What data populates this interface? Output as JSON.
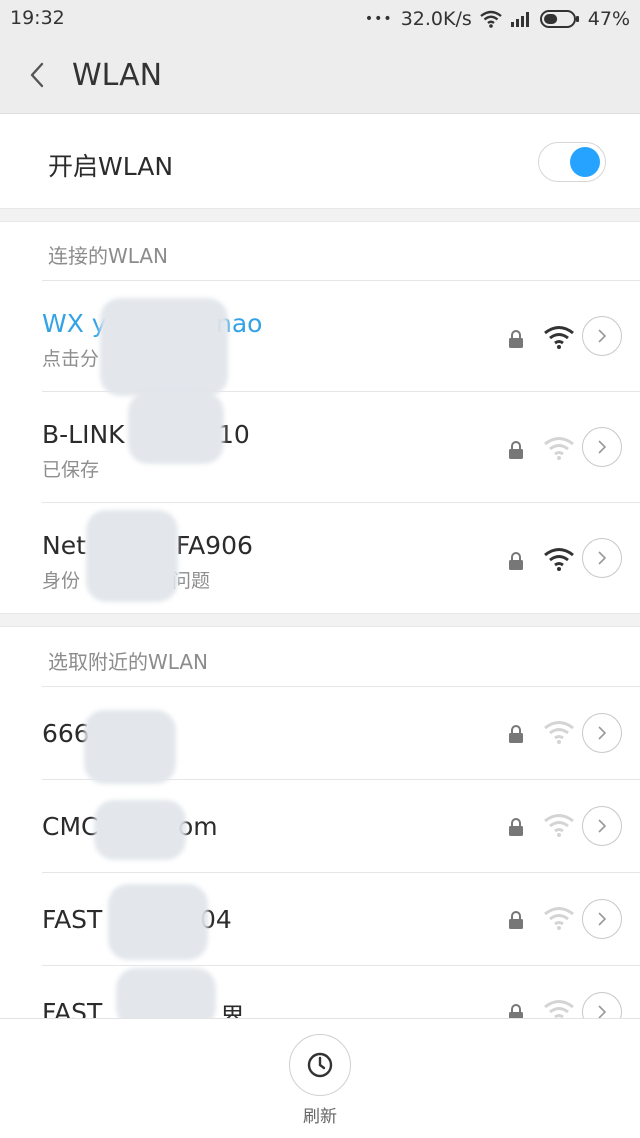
{
  "status_bar": {
    "time": "19:32",
    "dots": "•••",
    "speed": "32.0K/s",
    "battery": "47%",
    "battery_level": 0.47
  },
  "header": {
    "title": "WLAN"
  },
  "master_toggle": {
    "label": "开启WLAN",
    "on": true,
    "accent": "#26a3ff"
  },
  "connected_section": {
    "title": "连接的WLAN",
    "networks": [
      {
        "name": "WX y",
        "name_tail": "nao",
        "status": "点击分",
        "secured": true,
        "signal": "strong",
        "connected": true
      },
      {
        "name": "B-LINK",
        "name_tail": "10",
        "status": "已保存",
        "secured": true,
        "signal": "weak",
        "connected": false
      },
      {
        "name": "Net",
        "name_tail": "FA906",
        "status": "身份",
        "status_tail": "问题",
        "secured": true,
        "signal": "strong",
        "connected": false
      }
    ]
  },
  "nearby_section": {
    "title": "选取附近的WLAN",
    "networks": [
      {
        "name": "666",
        "secured": true,
        "signal": "weak"
      },
      {
        "name": "CMC",
        "name_tail": "om",
        "secured": true,
        "signal": "weak"
      },
      {
        "name": "FAST",
        "name_tail": "04",
        "secured": true,
        "signal": "weak"
      },
      {
        "name": "FAST",
        "name_tail": "界",
        "secured": true,
        "signal": "weak"
      }
    ]
  },
  "bottom_bar": {
    "refresh_label": "刷新",
    "icon": "power-clock-icon"
  },
  "colors": {
    "link_blue": "#33a3e6",
    "header_bg": "#ededed",
    "divider": "#e6e6e6"
  }
}
